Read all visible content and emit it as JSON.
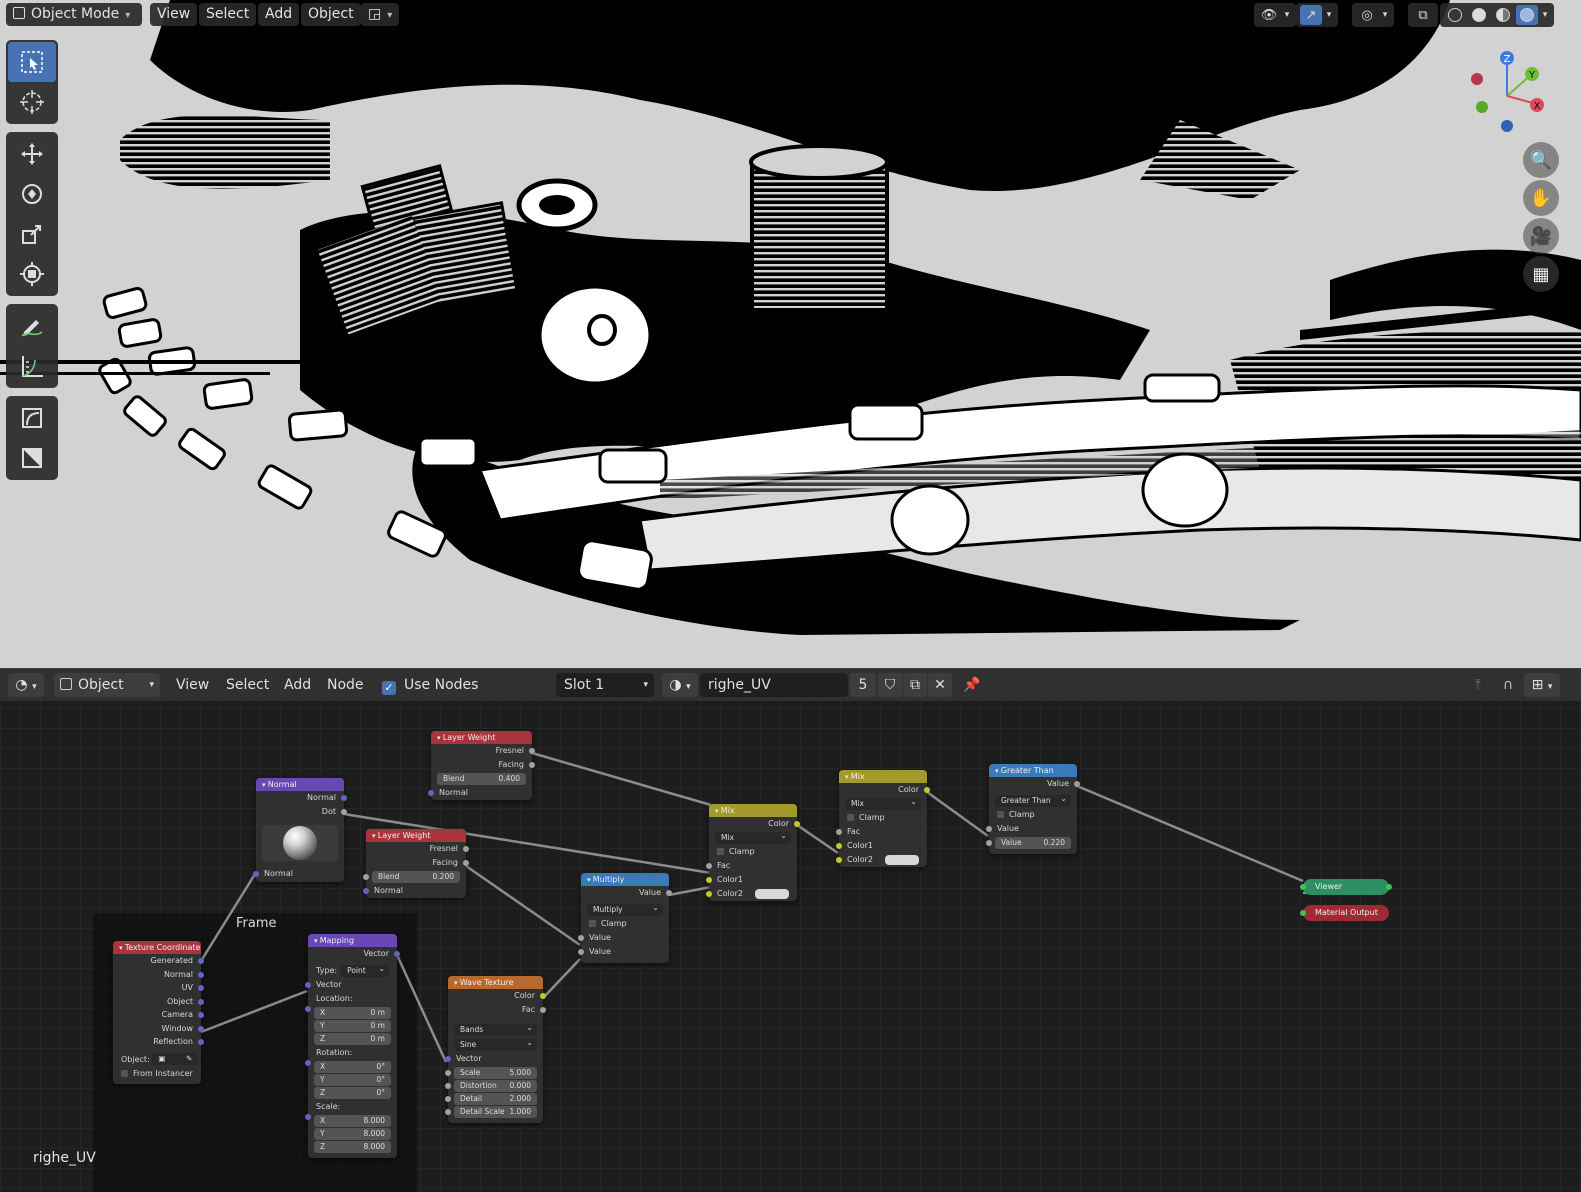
{
  "viewport": {
    "mode": "Object Mode",
    "menu": [
      "View",
      "Select",
      "Add",
      "Object"
    ]
  },
  "node_editor": {
    "editor_type": "Object",
    "menu": [
      "View",
      "Select",
      "Add",
      "Node"
    ],
    "use_nodes_label": "Use Nodes",
    "slot": "Slot 1",
    "material_name": "righe_UV",
    "user_count": "5",
    "frame_label": "Frame",
    "footer_name": "righe_UV"
  },
  "nodes": {
    "layer_weight_1": {
      "title": "Layer Weight",
      "fresnel": "Fresnel",
      "facing": "Facing",
      "blend_label": "Blend",
      "blend_value": "0.400",
      "normal": "Normal"
    },
    "normal": {
      "title": "Normal",
      "normal_out": "Normal",
      "dot": "Dot",
      "normal_in": "Normal"
    },
    "layer_weight_2": {
      "title": "Layer Weight",
      "fresnel": "Fresnel",
      "facing": "Facing",
      "blend_label": "Blend",
      "blend_value": "0.200",
      "normal": "Normal"
    },
    "mix_1": {
      "title": "Mix",
      "color": "Color",
      "blend": "Mix",
      "clamp": "Clamp",
      "fac": "Fac",
      "color1": "Color1",
      "color2": "Color2"
    },
    "mix_2": {
      "title": "Mix",
      "color": "Color",
      "blend": "Mix",
      "clamp": "Clamp",
      "fac": "Fac",
      "color1": "Color1",
      "color2": "Color2"
    },
    "greater_than": {
      "title": "Greater Than",
      "value_out": "Value",
      "operation": "Greater Than",
      "clamp": "Clamp",
      "value_in": "Value",
      "threshold_label": "Value",
      "threshold_value": "0.220"
    },
    "multiply": {
      "title": "Multiply",
      "value_out": "Value",
      "operation": "Multiply",
      "clamp": "Clamp",
      "value_a": "Value",
      "value_b": "Value"
    },
    "texture_coordinate": {
      "title": "Texture Coordinate",
      "outputs": [
        "Generated",
        "Normal",
        "UV",
        "Object",
        "Camera",
        "Window",
        "Reflection"
      ],
      "object_label": "Object",
      "from_instancer": "From Instancer"
    },
    "mapping": {
      "title": "Mapping",
      "vector_out": "Vector",
      "type_label": "Type:",
      "type_value": "Point",
      "vector_in": "Vector",
      "location_label": "Location:",
      "location": [
        [
          "X",
          "0 m"
        ],
        [
          "Y",
          "0 m"
        ],
        [
          "Z",
          "0 m"
        ]
      ],
      "rotation_label": "Rotation:",
      "rotation": [
        [
          "X",
          "0°"
        ],
        [
          "Y",
          "0°"
        ],
        [
          "Z",
          "0°"
        ]
      ],
      "scale_label": "Scale:",
      "scale": [
        [
          "X",
          "8.000"
        ],
        [
          "Y",
          "8.000"
        ],
        [
          "Z",
          "8.000"
        ]
      ]
    },
    "wave_texture": {
      "title": "Wave Texture",
      "color": "Color",
      "fac": "Fac",
      "wave_type": "Bands",
      "profile": "Sine",
      "vector": "Vector",
      "fields": [
        [
          "Scale",
          "5.000"
        ],
        [
          "Distortion",
          "0.000"
        ],
        [
          "Detail",
          "2.000"
        ],
        [
          "Detail Scale",
          "1.000"
        ]
      ]
    },
    "viewer": {
      "title": "Viewer"
    },
    "material_output": {
      "title": "Material Output"
    }
  }
}
